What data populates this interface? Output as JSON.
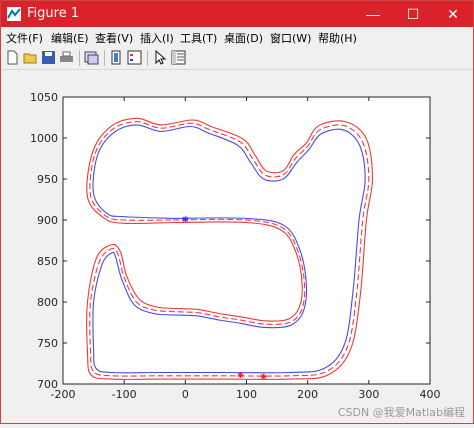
{
  "window": {
    "title": "Figure 1",
    "controls": {
      "minimize": "—",
      "maximize": "☐",
      "close": "✕"
    },
    "accent": "#d9222a"
  },
  "menu": [
    {
      "label": "文件(F)"
    },
    {
      "label": "编辑(E)"
    },
    {
      "label": "查看(V)"
    },
    {
      "label": "插入(I)"
    },
    {
      "label": "工具(T)"
    },
    {
      "label": "桌面(D)"
    },
    {
      "label": "窗口(W)"
    },
    {
      "label": "帮助(H)"
    }
  ],
  "toolbar": {
    "icons": [
      "new-figure-icon",
      "open-file-icon",
      "save-icon",
      "print-icon",
      "link-plot-icon",
      "insert-colorbar-icon",
      "insert-legend-icon",
      "edit-plot-arrow-icon",
      "property-inspector-icon"
    ]
  },
  "chart_data": {
    "type": "line",
    "title": "",
    "xlabel": "",
    "ylabel": "",
    "xlim": [
      -200,
      400
    ],
    "ylim": [
      700,
      1050
    ],
    "xticks": [
      -200,
      -100,
      0,
      100,
      200,
      300,
      400
    ],
    "yticks": [
      700,
      750,
      800,
      850,
      900,
      950,
      1000,
      1050
    ],
    "grid": false,
    "series": [
      {
        "role": "centerline",
        "color": "#ef3a3a",
        "style": "dashed",
        "points": [
          [
            -20,
            900
          ],
          [
            100,
            900
          ],
          [
            160,
            890
          ],
          [
            185,
            860
          ],
          [
            195,
            820
          ],
          [
            190,
            790
          ],
          [
            170,
            775
          ],
          [
            130,
            773
          ],
          [
            90,
            778
          ],
          [
            55,
            782
          ],
          [
            20,
            787
          ],
          [
            -10,
            788
          ],
          [
            -50,
            790
          ],
          [
            -80,
            800
          ],
          [
            -100,
            830
          ],
          [
            -110,
            858
          ],
          [
            -120,
            865
          ],
          [
            -140,
            850
          ],
          [
            -155,
            800
          ],
          [
            -155,
            740
          ],
          [
            -150,
            715
          ],
          [
            -120,
            710
          ],
          [
            -40,
            710
          ],
          [
            60,
            710
          ],
          [
            170,
            710
          ],
          [
            230,
            715
          ],
          [
            265,
            745
          ],
          [
            280,
            810
          ],
          [
            290,
            900
          ],
          [
            300,
            950
          ],
          [
            290,
            995
          ],
          [
            260,
            1015
          ],
          [
            220,
            1010
          ],
          [
            200,
            990
          ],
          [
            180,
            975
          ],
          [
            160,
            955
          ],
          [
            130,
            955
          ],
          [
            110,
            975
          ],
          [
            90,
            995
          ],
          [
            40,
            1010
          ],
          [
            10,
            1018
          ],
          [
            -40,
            1012
          ],
          [
            -80,
            1020
          ],
          [
            -120,
            1010
          ],
          [
            -148,
            980
          ],
          [
            -155,
            930
          ],
          [
            -130,
            905
          ],
          [
            -100,
            900
          ],
          [
            -20,
            900
          ]
        ]
      },
      {
        "role": "inner-boundary",
        "color": "#4a4ae8",
        "style": "solid",
        "points": [
          [
            -20,
            902
          ],
          [
            100,
            902
          ],
          [
            162,
            893
          ],
          [
            188,
            862
          ],
          [
            198,
            820
          ],
          [
            192,
            787
          ],
          [
            170,
            771
          ],
          [
            128,
            769
          ],
          [
            90,
            774
          ],
          [
            55,
            778
          ],
          [
            20,
            783
          ],
          [
            -10,
            784
          ],
          [
            -52,
            786
          ],
          [
            -84,
            797
          ],
          [
            -104,
            828
          ],
          [
            -114,
            855
          ],
          [
            -120,
            860
          ],
          [
            -136,
            846
          ],
          [
            -150,
            800
          ],
          [
            -150,
            742
          ],
          [
            -146,
            719
          ],
          [
            -120,
            714
          ],
          [
            -40,
            714
          ],
          [
            60,
            714
          ],
          [
            170,
            714
          ],
          [
            227,
            719
          ],
          [
            260,
            748
          ],
          [
            274,
            812
          ],
          [
            284,
            900
          ],
          [
            294,
            950
          ],
          [
            285,
            991
          ],
          [
            258,
            1010
          ],
          [
            222,
            1005
          ],
          [
            202,
            986
          ],
          [
            182,
            970
          ],
          [
            160,
            950
          ],
          [
            128,
            950
          ],
          [
            106,
            971
          ],
          [
            86,
            991
          ],
          [
            38,
            1006
          ],
          [
            8,
            1014
          ],
          [
            -40,
            1008
          ],
          [
            -80,
            1016
          ],
          [
            -118,
            1006
          ],
          [
            -144,
            978
          ],
          [
            -150,
            932
          ],
          [
            -128,
            908
          ],
          [
            -100,
            904
          ],
          [
            -20,
            902
          ]
        ]
      },
      {
        "role": "outer-boundary",
        "color": "#e83a3a",
        "style": "solid",
        "points": [
          [
            -20,
            897
          ],
          [
            100,
            897
          ],
          [
            158,
            887
          ],
          [
            182,
            858
          ],
          [
            191,
            820
          ],
          [
            186,
            793
          ],
          [
            168,
            779
          ],
          [
            132,
            777
          ],
          [
            90,
            782
          ],
          [
            55,
            786
          ],
          [
            20,
            791
          ],
          [
            -10,
            792
          ],
          [
            -48,
            794
          ],
          [
            -76,
            804
          ],
          [
            -96,
            832
          ],
          [
            -106,
            861
          ],
          [
            -120,
            870
          ],
          [
            -145,
            854
          ],
          [
            -160,
            800
          ],
          [
            -160,
            738
          ],
          [
            -154,
            711
          ],
          [
            -120,
            706
          ],
          [
            -40,
            706
          ],
          [
            60,
            706
          ],
          [
            170,
            706
          ],
          [
            233,
            711
          ],
          [
            270,
            742
          ],
          [
            286,
            808
          ],
          [
            296,
            900
          ],
          [
            306,
            950
          ],
          [
            296,
            999
          ],
          [
            262,
            1020
          ],
          [
            218,
            1015
          ],
          [
            198,
            994
          ],
          [
            178,
            980
          ],
          [
            160,
            960
          ],
          [
            132,
            960
          ],
          [
            114,
            979
          ],
          [
            94,
            999
          ],
          [
            42,
            1014
          ],
          [
            12,
            1022
          ],
          [
            -40,
            1016
          ],
          [
            -80,
            1024
          ],
          [
            -122,
            1014
          ],
          [
            -152,
            982
          ],
          [
            -160,
            928
          ],
          [
            -132,
            902
          ],
          [
            -100,
            896
          ],
          [
            -20,
            897
          ]
        ]
      }
    ],
    "markers": [
      {
        "x": 0,
        "y": 901,
        "color": "#3030ff",
        "symbol": "*"
      },
      {
        "x": 90,
        "y": 711,
        "color": "#e02020",
        "symbol": "*"
      },
      {
        "x": 128,
        "y": 709,
        "color": "#e02020",
        "symbol": "*"
      }
    ]
  },
  "watermark": "CSDN @我爱Matlab编程"
}
